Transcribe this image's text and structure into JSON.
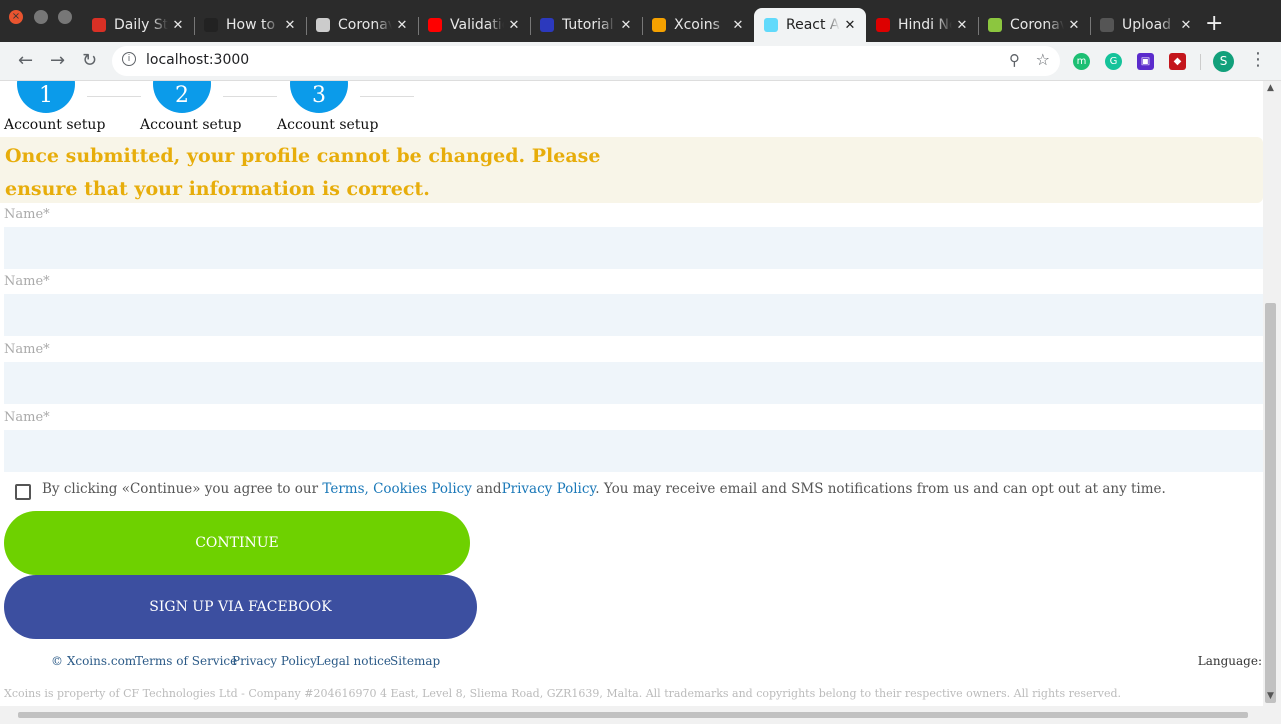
{
  "browser": {
    "tabs": [
      {
        "label": "Daily Stand-up",
        "favicon_color": "#d93025",
        "icon": "gmail-icon"
      },
      {
        "label": "How to",
        "favicon_color": "#222",
        "icon": "codesandbox-icon"
      },
      {
        "label": "Coronavirus",
        "favicon_color": "#ccc",
        "icon": "globe-icon"
      },
      {
        "label": "Validation",
        "favicon_color": "#f00",
        "icon": "youtube-icon"
      },
      {
        "label": "Tutorial",
        "favicon_color": "#2c39bd",
        "icon": "ethereum-icon"
      },
      {
        "label": "Xcoins",
        "favicon_color": "#f5a100",
        "icon": "xcoins-icon"
      },
      {
        "label": "React App",
        "favicon_color": "#61dafb",
        "icon": "react-icon",
        "active": true
      },
      {
        "label": "Hindi News",
        "favicon_color": "#d00",
        "icon": "om-icon"
      },
      {
        "label": "Coronavirus",
        "favicon_color": "#8cc63f",
        "icon": "upwork-icon"
      },
      {
        "label": "Upload",
        "favicon_color": "#555",
        "icon": "github-icon"
      }
    ],
    "url": "localhost:3000"
  },
  "steps": [
    {
      "number": "1",
      "label": "Account setup"
    },
    {
      "number": "2",
      "label": "Account setup"
    },
    {
      "number": "3",
      "label": "Account setup"
    }
  ],
  "notice": "Once submitted, your profile cannot be changed. Please ensure that your information is correct.",
  "fields": [
    {
      "label": "Name*",
      "value": ""
    },
    {
      "label": "Name*",
      "value": ""
    },
    {
      "label": "Name*",
      "value": ""
    },
    {
      "label": "Name*",
      "value": ""
    }
  ],
  "terms": {
    "prefix": "By clicking «Continue» you agree to our ",
    "link1": "Terms, Cookies Policy",
    "and": " and",
    "link2": "Privacy Policy",
    "suffix": ". You may receive email and SMS notifications from us and can opt out at any time.",
    "checked": false
  },
  "buttons": {
    "continue": "CONTINUE",
    "facebook": "SIGN UP VIA FACEBOOK"
  },
  "footer": {
    "links": [
      "© Xcoins.com",
      "Terms of Service",
      "Privacy Policy",
      "Legal notice",
      "Sitemap"
    ],
    "language": "Language:",
    "legal": "Xcoins is property of CF Technologies Ltd - Company #204616970 4 East, Level 8, Sliema Road, GZR1639, Malta. All trademarks and copyrights belong to their respective owners. All rights reserved."
  },
  "colors": {
    "accent": "#0b9bea",
    "continue": "#6ed100",
    "facebook": "#3c4fa0",
    "notice": "#e7ad0b"
  }
}
